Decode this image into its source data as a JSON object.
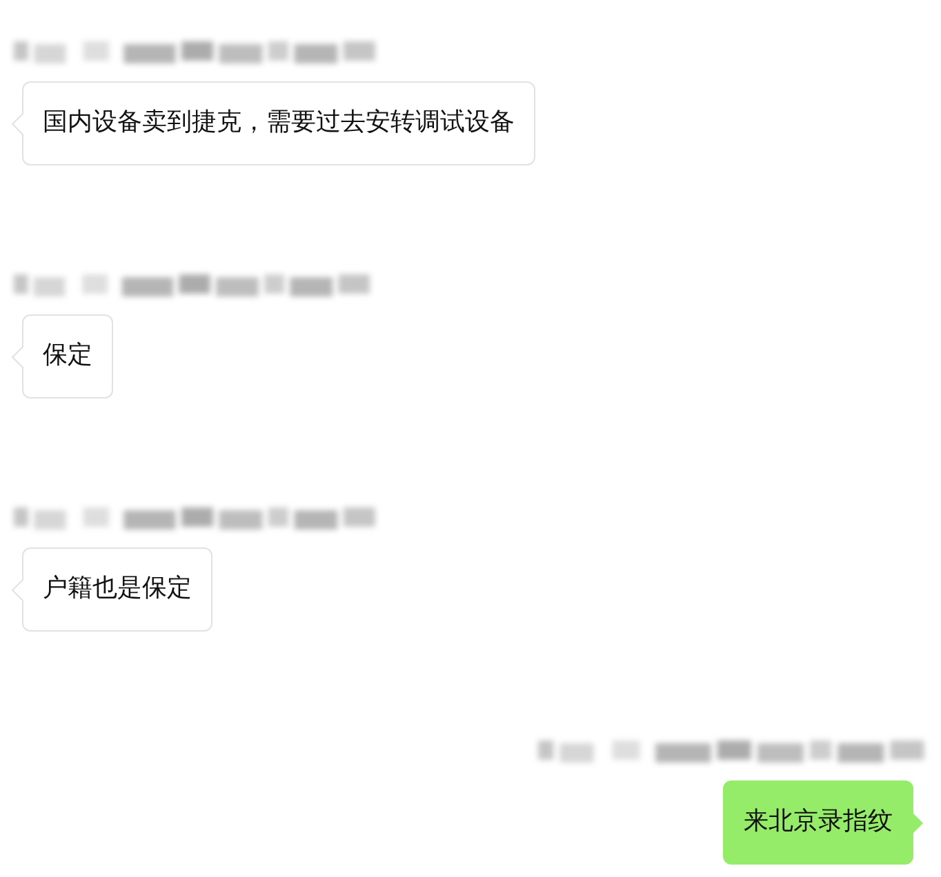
{
  "messages": [
    {
      "kind": "incoming",
      "text": "国内设备卖到捷克，需要过去安转调试设备"
    },
    {
      "kind": "incoming",
      "text": "保定"
    },
    {
      "kind": "incoming",
      "text": "户籍也是保定"
    },
    {
      "kind": "outgoing",
      "text": "来北京录指纹"
    }
  ]
}
